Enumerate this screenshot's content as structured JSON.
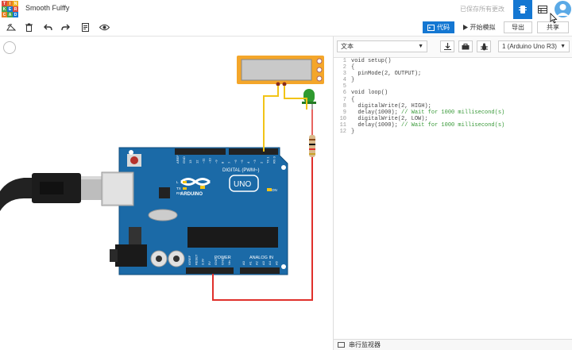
{
  "app": {
    "logo_letters": [
      "T",
      "I",
      "N",
      "K",
      "E",
      "R",
      "C",
      "A",
      "D"
    ],
    "logo_colors": [
      "#e04b3c",
      "#e87e22",
      "#f0b321",
      "#49a54d",
      "#1477d2",
      "#e04b3c",
      "#e87e22",
      "#49a54d",
      "#1477d2"
    ],
    "project_title": "Smooth Fulffy",
    "saved_status": "已保存所有更改"
  },
  "header_icons": {
    "circuit": "circuit-view-icon",
    "list": "component-list-icon",
    "avatar": "user-avatar-icon"
  },
  "toolbar": {
    "rotate": "rotate-icon",
    "delete": "trash-icon",
    "undo": "undo-icon",
    "redo": "redo-icon",
    "notes": "notes-icon",
    "visibility": "eye-icon",
    "code_label": "代码",
    "simulate_label": "开始模拟",
    "export_label": "导出",
    "share_label": "共享"
  },
  "code_panel": {
    "mode": "文本",
    "device": "1 (Arduino Uno R3)",
    "lines": [
      {
        "n": "1",
        "code": "void setup()",
        "comment": ""
      },
      {
        "n": "2",
        "code": "{",
        "comment": ""
      },
      {
        "n": "3",
        "code": "  pinMode(2, OUTPUT);",
        "comment": ""
      },
      {
        "n": "4",
        "code": "}",
        "comment": ""
      },
      {
        "n": "5",
        "code": "",
        "comment": ""
      },
      {
        "n": "6",
        "code": "void loop()",
        "comment": ""
      },
      {
        "n": "7",
        "code": "{",
        "comment": ""
      },
      {
        "n": "8",
        "code": "  digitalWrite(2, HIGH);",
        "comment": ""
      },
      {
        "n": "9",
        "code": "  delay(1000); ",
        "comment": "// Wait for 1000 millisecond(s)"
      },
      {
        "n": "10",
        "code": "  digitalWrite(2, LOW);",
        "comment": ""
      },
      {
        "n": "11",
        "code": "  delay(1000); ",
        "comment": "// Wait for 1000 millisecond(s)"
      },
      {
        "n": "12",
        "code": "}",
        "comment": ""
      }
    ],
    "serial_monitor": "串行监视器"
  },
  "board": {
    "label_digital": "DIGITAL (PWM~)",
    "label_brand": "ARDUINO",
    "label_uno": "UNO",
    "label_power": "POWER",
    "label_analog": "ANALOG IN",
    "label_on": "ON",
    "label_l": "L",
    "label_tx": "TX",
    "label_rx": "RX",
    "digital_pins": [
      "AREF",
      "GND",
      "13",
      "12",
      "~11",
      "~10",
      "~9",
      "8",
      "7",
      "~6",
      "~5",
      "4",
      "~3",
      "2",
      "TX 1",
      "RX 0"
    ],
    "power_pins": [
      "IOREF",
      "RESET",
      "3.3V",
      "5V",
      "GND",
      "GND",
      "Vin"
    ],
    "analog_pins": [
      "A0",
      "A1",
      "A2",
      "A3",
      "A4",
      "A5"
    ]
  },
  "colors": {
    "accent": "#1477d2",
    "board": "#1b6aa7",
    "wire_yellow": "#f2c417",
    "wire_red": "#e0302b",
    "led": "#2f9a2f",
    "lcd_border": "#f4a62a"
  }
}
